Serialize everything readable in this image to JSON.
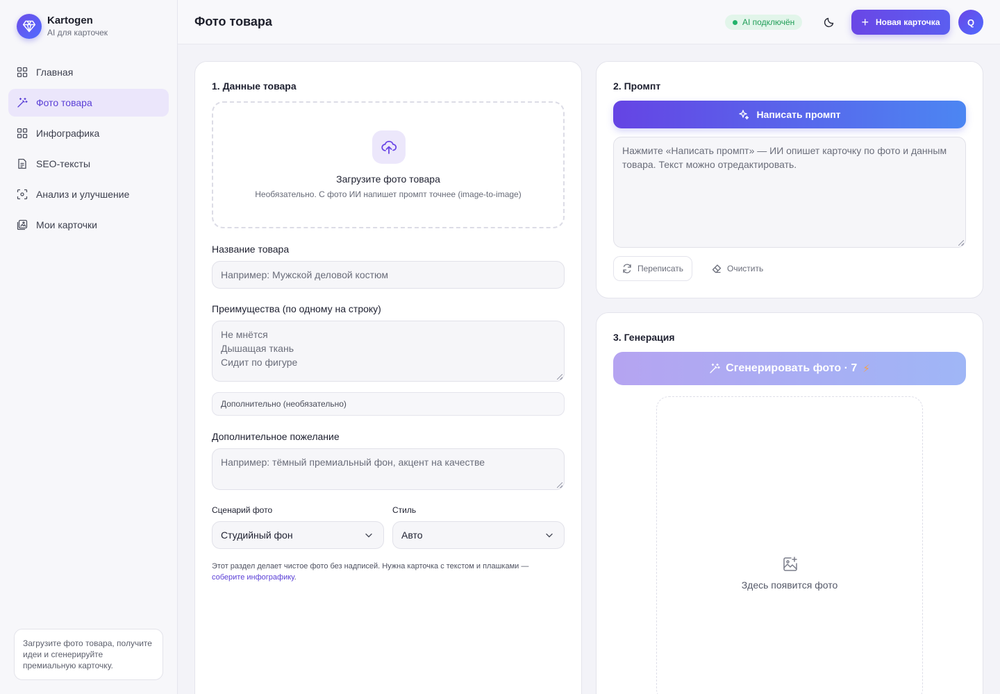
{
  "brand": {
    "name": "Kartogen",
    "subtitle": "AI для карточек"
  },
  "sidebar": {
    "items": [
      {
        "label": "Главная",
        "icon": "grid-icon"
      },
      {
        "label": "Фото товара",
        "icon": "magic-wand-icon",
        "active": true
      },
      {
        "label": "Инфографика",
        "icon": "grid-icon"
      },
      {
        "label": "SEO-тексты",
        "icon": "document-icon"
      },
      {
        "label": "Анализ и улучшение",
        "icon": "scan-icon"
      },
      {
        "label": "Мои карточки",
        "icon": "gallery-icon"
      }
    ],
    "hint": "Загрузите фото товара, получите идеи и сгенерируйте премиальную карточку."
  },
  "header": {
    "title": "Фото товара",
    "ai_status": "AI подключён",
    "new_card_label": "Новая карточка",
    "avatar_letter": "Q"
  },
  "product": {
    "title": "1. Данные товара",
    "upload_title": "Загрузите фото товара",
    "upload_sub": "Необязательно. С фото ИИ напишет промпт точнее (image-to-image)",
    "name_label": "Название товара",
    "name_placeholder": "Например: Мужской деловой костюм",
    "advantages_label": "Преимущества (по одному на строку)",
    "advantages": [
      "Не мнётся",
      "Дышащая ткань",
      "Сидит по фигуре"
    ],
    "extra_label": "Дополнительно (необязательно)",
    "wish_label": "Дополнительное пожелание",
    "wish_placeholder": "Например: тёмный премиальный фон, акцент на качестве",
    "scenario_label": "Сценарий фото",
    "scenario_value": "Студийный фон",
    "style_label": "Стиль",
    "style_value": "Авто",
    "note_text": "Этот раздел делает чистое фото без надписей. Нужна карточка с текстом и плашками —",
    "note_link": "соберите инфографику",
    "note_end": "."
  },
  "prompt": {
    "title": "2. Промпт",
    "write_label": "Написать промпт",
    "placeholder": "Нажмите «Написать промпт» — ИИ опишет карточку по фото и данным товара. Текст можно отредактировать.",
    "rewrite_label": "Переписать",
    "clear_label": "Очистить"
  },
  "generation": {
    "title": "3. Генерация",
    "button_label": "Сгенерировать фото · 7",
    "preview_text": "Здесь появится фото"
  },
  "colors": {
    "accent": "#6a46e6",
    "status": "#21b36a",
    "cost": "#f5a04a"
  }
}
